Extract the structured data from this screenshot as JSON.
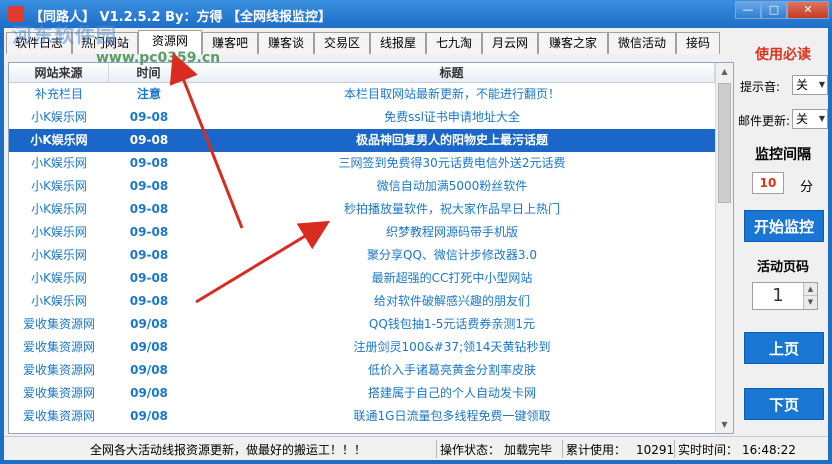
{
  "window": {
    "title": "【同路人】 V1.2.5.2  By：方得  【全网线报监控】",
    "minimize_glyph": "—",
    "maximize_glyph": "□",
    "close_glyph": "✕"
  },
  "watermark": {
    "text": "河东软件园",
    "url": "www.pc0359.cn"
  },
  "tabs": [
    {
      "label": "软件日志"
    },
    {
      "label": "热门网站"
    },
    {
      "label": "资源网"
    },
    {
      "label": "赚客吧"
    },
    {
      "label": "赚客谈"
    },
    {
      "label": "交易区"
    },
    {
      "label": "线报屋"
    },
    {
      "label": "七九淘"
    },
    {
      "label": "月云网"
    },
    {
      "label": "赚客之家"
    },
    {
      "label": "微信活动"
    },
    {
      "label": "接码"
    }
  ],
  "active_tab": "资源网",
  "columns": {
    "site": "网站来源",
    "time": "时间",
    "title": "标题"
  },
  "rows": [
    {
      "site": "补充栏目",
      "time": "注意",
      "title": "本栏目取网站最新更新，不能进行翻页！"
    },
    {
      "site": "小K娱乐网",
      "time": "09-08",
      "title": "免费ssl证书申请地址大全"
    },
    {
      "site": "小K娱乐网",
      "time": "09-08",
      "title": "极品神回复男人的阳物史上最污话题"
    },
    {
      "site": "小K娱乐网",
      "time": "09-08",
      "title": "三网签到免费得30元话费电信外送2元话费"
    },
    {
      "site": "小K娱乐网",
      "time": "09-08",
      "title": "微信自动加满5000粉丝软件"
    },
    {
      "site": "小K娱乐网",
      "time": "09-08",
      "title": "秒拍播放量软件，祝大家作品早日上热门"
    },
    {
      "site": "小K娱乐网",
      "time": "09-08",
      "title": "织梦教程网源码带手机版"
    },
    {
      "site": "小K娱乐网",
      "time": "09-08",
      "title": "聚分享QQ、微信计步修改器3.0"
    },
    {
      "site": "小K娱乐网",
      "time": "09-08",
      "title": "最新超强的CC打死中小型网站"
    },
    {
      "site": "小K娱乐网",
      "time": "09-08",
      "title": "给对软件破解感兴趣的朋友们"
    },
    {
      "site": "爱收集资源网",
      "time": "09/08",
      "title": "QQ钱包抽1-5元话费券亲测1元"
    },
    {
      "site": "爱收集资源网",
      "time": "09/08",
      "title": "注册剑灵100&#37;领14天黄钻秒到"
    },
    {
      "site": "爱收集资源网",
      "time": "09/08",
      "title": "低价入手诸葛亮黄金分割率皮肤"
    },
    {
      "site": "爱收集资源网",
      "time": "09/08",
      "title": "搭建属于自己的个人自动发卡网"
    },
    {
      "site": "爱收集资源网",
      "time": "09/08",
      "title": "联通1G日流量包多线程免费一键领取"
    }
  ],
  "selected_row_index": 2,
  "panel": {
    "title": "使用必读",
    "sound_label": "提示音:",
    "sound_value": "关",
    "mail_label": "邮件更新:",
    "mail_value": "关",
    "interval_label": "监控间隔",
    "interval_value": "10",
    "interval_unit": "分",
    "start_button": "开始监控",
    "page_label": "活动页码",
    "page_value": "1",
    "prev_button": "上页",
    "next_button": "下页"
  },
  "status": {
    "message": "全网各大活动线报资源更新，做最好的搬运工！！！",
    "op_label": "操作状态：",
    "op_value": "加载完毕",
    "usage_label": "累计使用：",
    "usage_value": "10291",
    "time_label": "实时时间：",
    "time_value": "16:48:22"
  },
  "colors": {
    "link_blue": "#1a78c8",
    "selected_bg": "#1a67c9",
    "accent_red": "#e0311b",
    "button_blue": "#1976d2",
    "arrow_red": "#d92b20"
  }
}
